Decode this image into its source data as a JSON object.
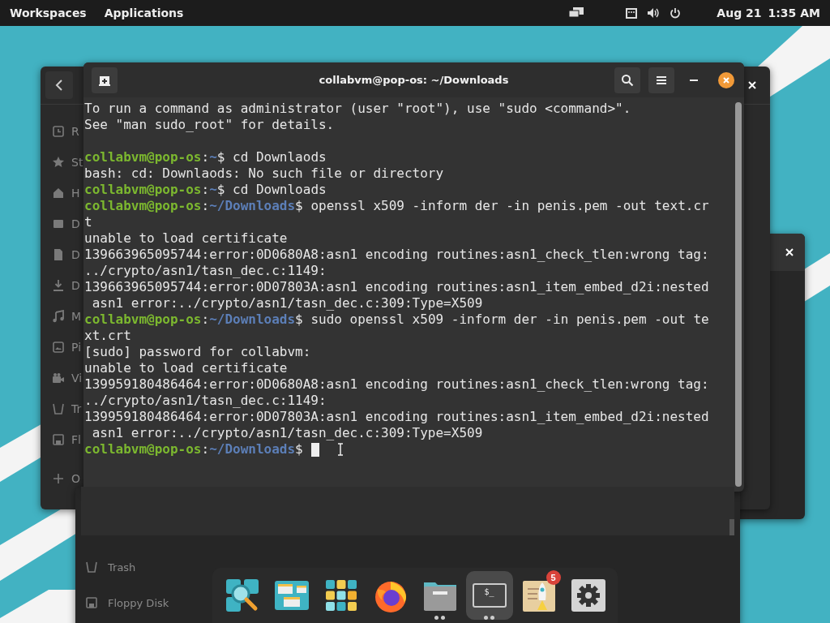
{
  "top_bar": {
    "workspaces": "Workspaces",
    "applications": "Applications",
    "date": "Aug 21",
    "time": "1:35 AM"
  },
  "file_manager": {
    "sidebar_items": [
      {
        "kind": "clock",
        "label": "R"
      },
      {
        "kind": "star",
        "label": "St"
      },
      {
        "kind": "home",
        "label": "H"
      },
      {
        "kind": "desktop",
        "label": "D"
      },
      {
        "kind": "document",
        "label": "D"
      },
      {
        "kind": "download",
        "label": "D"
      },
      {
        "kind": "music",
        "label": "M"
      },
      {
        "kind": "image",
        "label": "Pi"
      },
      {
        "kind": "camera",
        "label": "Vi"
      },
      {
        "kind": "trash",
        "label": "Tr"
      },
      {
        "kind": "floppy",
        "label": "Fl"
      },
      {
        "kind": "plus",
        "label": "O"
      }
    ]
  },
  "lower_file_manager": {
    "sidebar_items": [
      {
        "kind": "trash",
        "label": "Trash"
      },
      {
        "kind": "floppy",
        "label": "Floppy Disk"
      }
    ]
  },
  "terminal": {
    "title": "collabvm@pop-os: ~/Downloads",
    "lines": [
      {
        "kind": "output",
        "text": "To run a command as administrator (user \"root\"), use \"sudo <command>\"."
      },
      {
        "kind": "output",
        "text": "See \"man sudo_root\" for details."
      },
      {
        "kind": "blank"
      },
      {
        "kind": "prompt",
        "user": "collabvm@pop-os",
        "separator": ":",
        "path": "~",
        "symbol": "$",
        "command": "cd Downlaods"
      },
      {
        "kind": "output",
        "text": "bash: cd: Downlaods: No such file or directory"
      },
      {
        "kind": "prompt",
        "user": "collabvm@pop-os",
        "separator": ":",
        "path": "~",
        "symbol": "$",
        "command": "cd Downloads"
      },
      {
        "kind": "prompt",
        "user": "collabvm@pop-os",
        "separator": ":",
        "path": "~/Downloads",
        "symbol": "$",
        "command": "openssl x509 -inform der -in penis.pem -out text.cr"
      },
      {
        "kind": "output",
        "text": "t"
      },
      {
        "kind": "output",
        "text": "unable to load certificate"
      },
      {
        "kind": "output",
        "text": "139663965095744:error:0D0680A8:asn1 encoding routines:asn1_check_tlen:wrong tag:"
      },
      {
        "kind": "output",
        "text": "../crypto/asn1/tasn_dec.c:1149:"
      },
      {
        "kind": "output",
        "text": "139663965095744:error:0D07803A:asn1 encoding routines:asn1_item_embed_d2i:nested"
      },
      {
        "kind": "output",
        "text": " asn1 error:../crypto/asn1/tasn_dec.c:309:Type=X509"
      },
      {
        "kind": "prompt",
        "user": "collabvm@pop-os",
        "separator": ":",
        "path": "~/Downloads",
        "symbol": "$",
        "command": "sudo openssl x509 -inform der -in penis.pem -out te"
      },
      {
        "kind": "output",
        "text": "xt.crt"
      },
      {
        "kind": "output",
        "text": "[sudo] password for collabvm:"
      },
      {
        "kind": "output",
        "text": "unable to load certificate"
      },
      {
        "kind": "output",
        "text": "139959180486464:error:0D0680A8:asn1 encoding routines:asn1_check_tlen:wrong tag:"
      },
      {
        "kind": "output",
        "text": "../crypto/asn1/tasn_dec.c:1149:"
      },
      {
        "kind": "output",
        "text": "139959180486464:error:0D07803A:asn1 encoding routines:asn1_item_embed_d2i:nested"
      },
      {
        "kind": "output",
        "text": " asn1 error:../crypto/asn1/tasn_dec.c:309:Type=X509"
      },
      {
        "kind": "prompt",
        "user": "collabvm@pop-os",
        "separator": ":",
        "path": "~/Downloads",
        "symbol": "$",
        "cursor": true
      }
    ]
  },
  "dock": {
    "items": [
      {
        "kind": "search",
        "running": false,
        "selected": false
      },
      {
        "kind": "workspaces",
        "running": false,
        "selected": false
      },
      {
        "kind": "apps",
        "running": false,
        "selected": false
      },
      {
        "kind": "browser",
        "running": false,
        "selected": false
      },
      {
        "kind": "files",
        "running": true,
        "selected": false
      },
      {
        "kind": "terminal",
        "running": true,
        "selected": true,
        "glyph": "$_"
      },
      {
        "kind": "updater",
        "running": false,
        "selected": false,
        "badge": "5"
      },
      {
        "kind": "settings",
        "running": false,
        "selected": false
      }
    ]
  }
}
